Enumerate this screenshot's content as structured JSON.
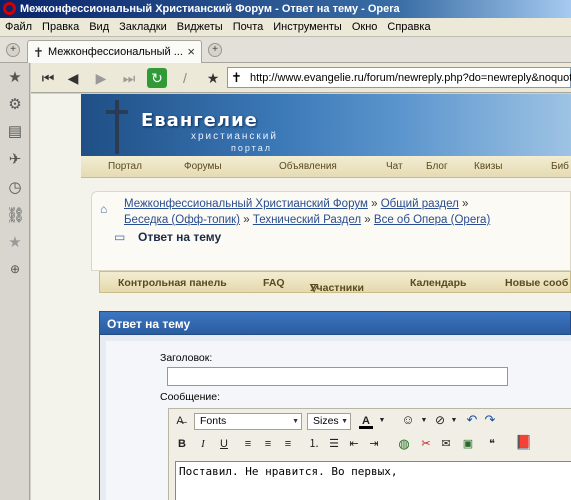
{
  "window": {
    "title": "Межконфессиональный Христианский Форум - Ответ на тему - Opera"
  },
  "menu": [
    "Файл",
    "Правка",
    "Вид",
    "Закладки",
    "Виджеты",
    "Почта",
    "Инструменты",
    "Окно",
    "Справка"
  ],
  "tab": {
    "label": "Межконфессиональный ..."
  },
  "address": {
    "url": "http://www.evangelie.ru/forum/newreply.php?do=newreply&noquote="
  },
  "site": {
    "name": "Евангелие",
    "subtitle1": "христианский",
    "subtitle2": "портал",
    "nav": [
      "Портал",
      "Форумы",
      "Объявления",
      "Чат",
      "Блог",
      "Квизы",
      "Биб"
    ]
  },
  "breadcrumb": {
    "root": "Межконфессиональный Христианский Форум",
    "level1": "Общий раздел",
    "level2": "Беседка (Офф-топик)",
    "level3": "Технический Раздел",
    "level4": "Все об Опера (Opera)",
    "sep": "»",
    "current": "Ответ на тему"
  },
  "forumnav": {
    "control_panel": "Контрольная панель",
    "faq": "FAQ",
    "members": "Участники",
    "calendar": "Календарь",
    "new_posts": "Новые сооб"
  },
  "reply": {
    "header": "Ответ на тему",
    "subject_label": "Заголовок:",
    "subject_value": "",
    "message_label": "Сообщение:",
    "font_select": "Fonts",
    "size_select": "Sizes",
    "message_text": "Поставил. Не нравится. Во первых,"
  },
  "colors": {
    "title_gradient_start": "#0a246a",
    "link": "#2a4d8f",
    "reply_header": "#2a5c9f"
  }
}
